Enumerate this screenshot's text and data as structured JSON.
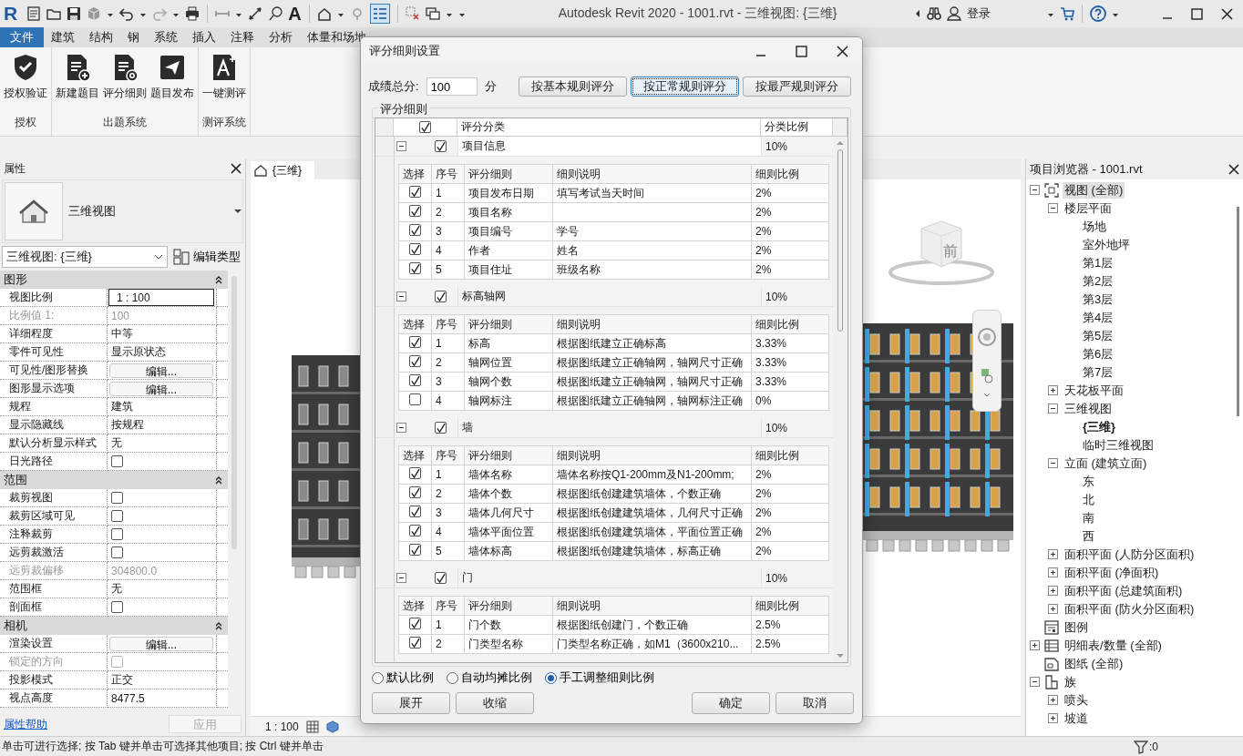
{
  "app": {
    "logo": "R",
    "text_tool": "A",
    "title": "Autodesk Revit 2020 - 1001.rvt - 三维视图: {三维}",
    "login": "登录"
  },
  "menu_tabs": [
    {
      "label": "文件",
      "kind": "app"
    },
    {
      "label": "建筑",
      "kind": "tab"
    },
    {
      "label": "结构",
      "kind": "tab"
    },
    {
      "label": "钢",
      "kind": "tab"
    },
    {
      "label": "系统",
      "kind": "tab"
    },
    {
      "label": "插入",
      "kind": "tab"
    },
    {
      "label": "注释",
      "kind": "tab"
    },
    {
      "label": "分析",
      "kind": "tab"
    },
    {
      "label": "体量和场地",
      "kind": "tab"
    }
  ],
  "ribbon": {
    "groups": [
      {
        "label": "授权",
        "buttons": [
          {
            "label": "授权验证",
            "kind": "shield"
          }
        ]
      },
      {
        "label": "出题系统",
        "buttons": [
          {
            "label": "新建题目",
            "kind": "doc-plus"
          },
          {
            "label": "评分细则",
            "kind": "doc-gear"
          },
          {
            "label": "题目发布",
            "kind": "send"
          }
        ]
      },
      {
        "label": "测评系统",
        "buttons": [
          {
            "label": "一键测评",
            "kind": "a-plus"
          }
        ]
      }
    ]
  },
  "properties": {
    "title": "属性",
    "type_name": "三维视图",
    "view_selector": "三维视图: {三维}",
    "edit_type": "编辑类型",
    "groups": [
      {
        "label": "图形",
        "expanded": true,
        "rows": [
          {
            "name": "视图比例",
            "kind": "field",
            "value": "1 : 100",
            "disabled": false
          },
          {
            "name": "比例值 1:",
            "kind": "text",
            "value": "100",
            "disabled": true
          },
          {
            "name": "详细程度",
            "kind": "text",
            "value": "中等",
            "disabled": false
          },
          {
            "name": "零件可见性",
            "kind": "text",
            "value": "显示原状态",
            "disabled": false
          },
          {
            "name": "可见性/图形替换",
            "kind": "button",
            "value": "编辑...",
            "disabled": false
          },
          {
            "name": "图形显示选项",
            "kind": "button",
            "value": "编辑...",
            "disabled": false
          },
          {
            "name": "规程",
            "kind": "text",
            "value": "建筑",
            "disabled": false
          },
          {
            "name": "显示隐藏线",
            "kind": "text",
            "value": "按规程",
            "disabled": false
          },
          {
            "name": "默认分析显示样式",
            "kind": "text",
            "value": "无",
            "disabled": false
          },
          {
            "name": "日光路径",
            "kind": "checkbox",
            "checked": false,
            "disabled": false
          }
        ]
      },
      {
        "label": "范围",
        "expanded": true,
        "rows": [
          {
            "name": "裁剪视图",
            "kind": "checkbox",
            "checked": false,
            "disabled": false
          },
          {
            "name": "裁剪区域可见",
            "kind": "checkbox",
            "checked": false,
            "disabled": false
          },
          {
            "name": "注释裁剪",
            "kind": "checkbox",
            "checked": false,
            "disabled": false
          },
          {
            "name": "远剪裁激活",
            "kind": "checkbox",
            "checked": false,
            "disabled": false
          },
          {
            "name": "远剪裁偏移",
            "kind": "text",
            "value": "304800.0",
            "disabled": true
          },
          {
            "name": "范围框",
            "kind": "text",
            "value": "无",
            "disabled": false
          },
          {
            "name": "剖面框",
            "kind": "checkbox",
            "checked": false,
            "disabled": false
          }
        ]
      },
      {
        "label": "相机",
        "expanded": true,
        "rows": [
          {
            "name": "渲染设置",
            "kind": "button",
            "value": "编辑...",
            "disabled": false
          },
          {
            "name": "锁定的方向",
            "kind": "checkbox",
            "checked": false,
            "disabled": true
          },
          {
            "name": "投影模式",
            "kind": "text",
            "value": "正交",
            "disabled": false
          },
          {
            "name": "视点高度",
            "kind": "text",
            "value": "8477.5",
            "disabled": false
          }
        ]
      }
    ],
    "help_link": "属性帮助",
    "apply": "应用",
    "apply_disabled": true
  },
  "view": {
    "tab_label": "{三维}",
    "viewcube_face": "前",
    "scale": "1 : 100"
  },
  "browser": {
    "title": "项目浏览器 - 1001.rvt",
    "tree": [
      {
        "label": "视图 (全部)",
        "kind": "views",
        "expanded": true,
        "selected": true,
        "current": false,
        "children": [
          {
            "label": "楼层平面",
            "expanded": true,
            "selected": false,
            "current": false,
            "children": [
              {
                "label": "场地",
                "selected": false,
                "current": false
              },
              {
                "label": "室外地坪",
                "selected": false,
                "current": false
              },
              {
                "label": "第1层",
                "selected": false,
                "current": false
              },
              {
                "label": "第2层",
                "selected": false,
                "current": false
              },
              {
                "label": "第3层",
                "selected": false,
                "current": false
              },
              {
                "label": "第4层",
                "selected": false,
                "current": false
              },
              {
                "label": "第5层",
                "selected": false,
                "current": false
              },
              {
                "label": "第6层",
                "selected": false,
                "current": false
              },
              {
                "label": "第7层",
                "selected": false,
                "current": false
              }
            ]
          },
          {
            "label": "天花板平面",
            "expanded": false,
            "selected": false,
            "current": false
          },
          {
            "label": "三维视图",
            "expanded": true,
            "selected": false,
            "current": false,
            "children": [
              {
                "label": "{三维}",
                "selected": false,
                "current": true
              },
              {
                "label": "临时三维视图",
                "selected": false,
                "current": false
              }
            ]
          },
          {
            "label": "立面 (建筑立面)",
            "expanded": true,
            "selected": false,
            "current": false,
            "children": [
              {
                "label": "东",
                "selected": false,
                "current": false
              },
              {
                "label": "北",
                "selected": false,
                "current": false
              },
              {
                "label": "南",
                "selected": false,
                "current": false
              },
              {
                "label": "西",
                "selected": false,
                "current": false
              }
            ]
          },
          {
            "label": "面积平面 (人防分区面积)",
            "expanded": false,
            "selected": false,
            "current": false
          },
          {
            "label": "面积平面 (净面积)",
            "expanded": false,
            "selected": false,
            "current": false
          },
          {
            "label": "面积平面 (总建筑面积)",
            "expanded": false,
            "selected": false,
            "current": false
          },
          {
            "label": "面积平面 (防火分区面积)",
            "expanded": false,
            "selected": false,
            "current": false
          }
        ]
      },
      {
        "label": "图例",
        "kind": "legend",
        "selected": false,
        "current": false
      },
      {
        "label": "明细表/数量 (全部)",
        "kind": "schedule",
        "expanded": false,
        "selected": false,
        "current": false
      },
      {
        "label": "图纸 (全部)",
        "kind": "sheet",
        "selected": false,
        "current": false
      },
      {
        "label": "族",
        "kind": "family",
        "expanded": true,
        "selected": false,
        "current": false,
        "children": [
          {
            "label": "喷头",
            "expanded": false,
            "selected": false,
            "current": false
          },
          {
            "label": "坡道",
            "expanded": false,
            "selected": false,
            "current": false
          }
        ]
      }
    ]
  },
  "status_bar": {
    "message": "单击可进行选择; 按 Tab 键并单击可选择其他项目; 按 Ctrl 键并单击",
    "filter_count": ":0"
  },
  "dialog": {
    "title": "评分细则设置",
    "total_label": "成绩总分:",
    "total_value": "100",
    "total_unit": "分",
    "mode_buttons": [
      {
        "label": "按基本规则评分",
        "focused": false
      },
      {
        "label": "按正常规则评分",
        "focused": true
      },
      {
        "label": "按最严规则评分",
        "focused": false
      }
    ],
    "group_label": "评分细则",
    "all_checked": true,
    "columns": [
      "评分分类",
      "分类比例"
    ],
    "categories": [
      {
        "name": "项目信息",
        "ratio": "10%",
        "checked": true,
        "expanded": true,
        "selected": true,
        "columns": [
          "选择",
          "序号",
          "评分细则",
          "细则说明",
          "细则比例"
        ],
        "rows": [
          {
            "checked": true,
            "no": "1",
            "rule": "项目发布日期",
            "desc": "填写考试当天时间",
            "ratio": "2%"
          },
          {
            "checked": true,
            "no": "2",
            "rule": "项目名称",
            "desc": "",
            "ratio": "2%"
          },
          {
            "checked": true,
            "no": "3",
            "rule": "项目编号",
            "desc": "学号",
            "ratio": "2%"
          },
          {
            "checked": true,
            "no": "4",
            "rule": "作者",
            "desc": "姓名",
            "ratio": "2%"
          },
          {
            "checked": true,
            "no": "5",
            "rule": "项目住址",
            "desc": "班级名称",
            "ratio": "2%"
          }
        ]
      },
      {
        "name": "标高轴网",
        "ratio": "10%",
        "checked": true,
        "expanded": true,
        "selected": false,
        "columns": [
          "选择",
          "序号",
          "评分细则",
          "细则说明",
          "细则比例"
        ],
        "rows": [
          {
            "checked": true,
            "no": "1",
            "rule": "标高",
            "desc": "根据图纸建立正确标高",
            "ratio": "3.33%"
          },
          {
            "checked": true,
            "no": "2",
            "rule": "轴网位置",
            "desc": "根据图纸建立正确轴网，轴网尺寸正确",
            "ratio": "3.33%"
          },
          {
            "checked": true,
            "no": "3",
            "rule": "轴网个数",
            "desc": "根据图纸建立正确轴网，轴网尺寸正确",
            "ratio": "3.33%"
          },
          {
            "checked": false,
            "no": "4",
            "rule": "轴网标注",
            "desc": "根据图纸建立正确轴网，轴网标注正确",
            "ratio": "0%"
          }
        ]
      },
      {
        "name": "墙",
        "ratio": "10%",
        "checked": true,
        "expanded": true,
        "selected": false,
        "columns": [
          "选择",
          "序号",
          "评分细则",
          "细则说明",
          "细则比例"
        ],
        "rows": [
          {
            "checked": true,
            "no": "1",
            "rule": "墙体名称",
            "desc": "墙体名称按Q1-200mm及N1-200mm;",
            "ratio": "2%"
          },
          {
            "checked": true,
            "no": "2",
            "rule": "墙体个数",
            "desc": "根据图纸创建建筑墙体，个数正确",
            "ratio": "2%"
          },
          {
            "checked": true,
            "no": "3",
            "rule": "墙体几何尺寸",
            "desc": "根据图纸创建建筑墙体，几何尺寸正确",
            "ratio": "2%"
          },
          {
            "checked": true,
            "no": "4",
            "rule": "墙体平面位置",
            "desc": "根据图纸创建建筑墙体，平面位置正确",
            "ratio": "2%"
          },
          {
            "checked": true,
            "no": "5",
            "rule": "墙体标高",
            "desc": "根据图纸创建建筑墙体，标高正确",
            "ratio": "2%"
          }
        ]
      },
      {
        "name": "门",
        "ratio": "10%",
        "checked": true,
        "expanded": true,
        "selected": false,
        "columns": [
          "选择",
          "序号",
          "评分细则",
          "细则说明",
          "细则比例"
        ],
        "rows": [
          {
            "checked": true,
            "no": "1",
            "rule": "门个数",
            "desc": "根据图纸创建门，个数正确",
            "ratio": "2.5%"
          },
          {
            "checked": true,
            "no": "2",
            "rule": "门类型名称",
            "desc": "门类型名称正确，如M1（3600x210...",
            "ratio": "2.5%"
          }
        ]
      }
    ],
    "ratio_modes": [
      {
        "label": "默认比例",
        "selected": false
      },
      {
        "label": "自动均摊比例",
        "selected": false
      },
      {
        "label": "手工调整细则比例",
        "selected": true
      }
    ],
    "left_buttons": [
      "展开",
      "收缩"
    ],
    "right_buttons": [
      "确定",
      "取消"
    ]
  }
}
